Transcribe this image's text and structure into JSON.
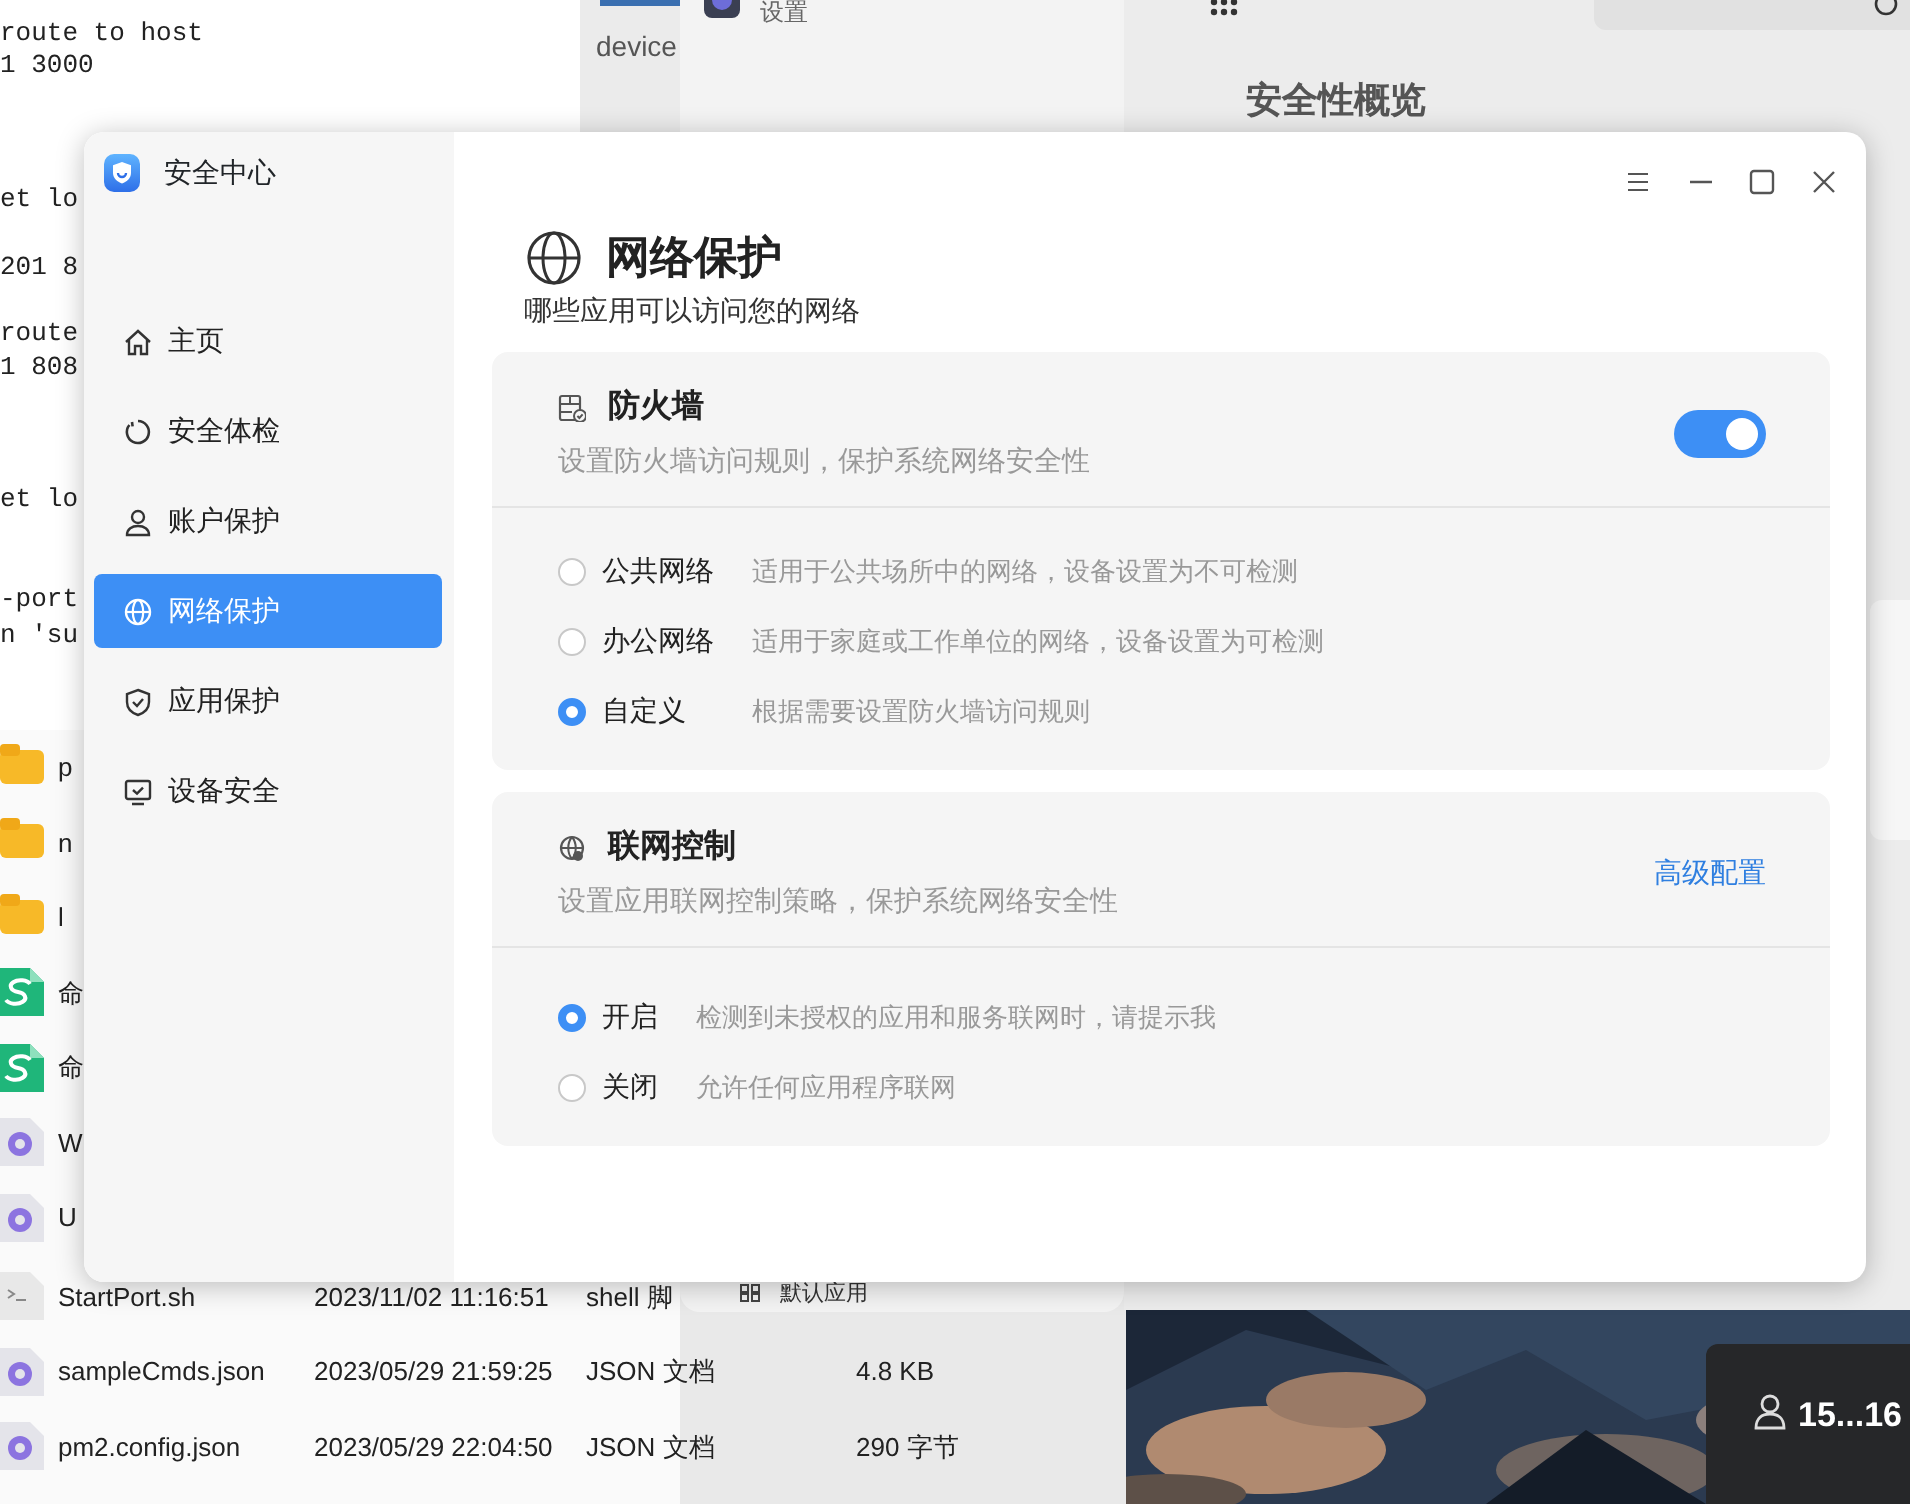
{
  "desktop": {
    "terminal": {
      "lines": [
        "route to host",
        "1 3000",
        "et lo",
        "201 8",
        "route",
        "1 808",
        "et lo",
        "-port",
        "n 'su"
      ]
    },
    "side_strip": {
      "text": "device"
    },
    "settings_window": {
      "title": "设置",
      "items": [
        "默认应用"
      ]
    },
    "overview": {
      "title": "安全性概览"
    },
    "file_list": {
      "rows": [
        {
          "kind": "folder",
          "name": "p"
        },
        {
          "kind": "folder",
          "name": "n"
        },
        {
          "kind": "folder",
          "name": "l"
        },
        {
          "kind": "sheet",
          "name": "命"
        },
        {
          "kind": "sheet",
          "name": "命"
        },
        {
          "kind": "json",
          "name": "W"
        },
        {
          "kind": "json",
          "name": "U"
        },
        {
          "kind": "script",
          "name": "StartPort.sh",
          "modified": "2023/11/02 11:16:51",
          "type": "shell 脚"
        },
        {
          "kind": "json",
          "name": "sampleCmds.json",
          "modified": "2023/05/29 21:59:25",
          "type": "JSON 文档",
          "size": "4.8 KB"
        },
        {
          "kind": "json",
          "name": "pm2.config.json",
          "modified": "2023/05/29 22:04:50",
          "type": "JSON 文档",
          "size": "290 字节"
        }
      ]
    },
    "user_panel": {
      "label": "15...16"
    }
  },
  "app": {
    "title": "安全中心",
    "nav": [
      {
        "label": "主页",
        "selected": false
      },
      {
        "label": "安全体检",
        "selected": false
      },
      {
        "label": "账户保护",
        "selected": false
      },
      {
        "label": "网络保护",
        "selected": true
      },
      {
        "label": "应用保护",
        "selected": false
      },
      {
        "label": "设备安全",
        "selected": false
      }
    ],
    "page": {
      "title": "网络保护",
      "subtitle": "哪些应用可以访问您的网络"
    },
    "sections": [
      {
        "title": "防火墙",
        "description": "设置防火墙访问规则，保护系统网络安全性",
        "toggle": {
          "on": true
        },
        "options": [
          {
            "label": "公共网络",
            "description": "适用于公共场所中的网络，设备设置为不可检测",
            "selected": false
          },
          {
            "label": "办公网络",
            "description": "适用于家庭或工作单位的网络，设备设置为可检测",
            "selected": false
          },
          {
            "label": "自定义",
            "description": "根据需要设置防火墙访问规则",
            "selected": true
          }
        ]
      },
      {
        "title": "联网控制",
        "description": "设置应用联网控制策略，保护系统网络安全性",
        "link": "高级配置",
        "options": [
          {
            "label": "开启",
            "description": "检测到未授权的应用和服务联网时，请提示我",
            "selected": true
          },
          {
            "label": "关闭",
            "description": "允许任何应用程序联网",
            "selected": false
          }
        ]
      }
    ]
  }
}
